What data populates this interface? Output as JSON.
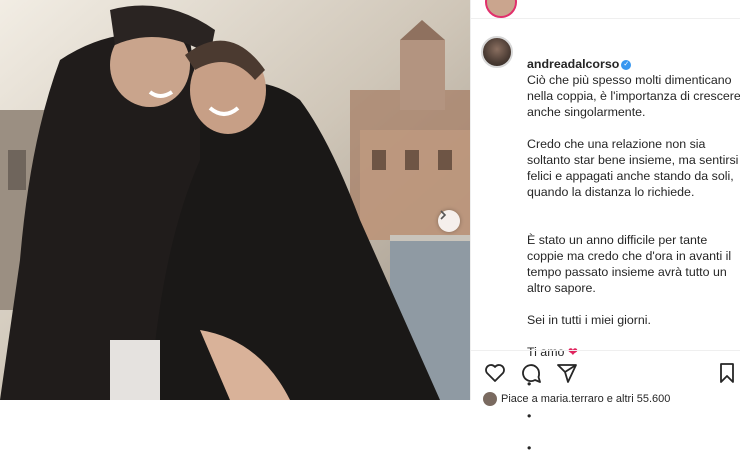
{
  "post": {
    "author": "andreadalcorso",
    "caption_first": "Ciò che più spesso molti dimenticano nella coppia, è l'importanza di crescere anche singolarmente.",
    "caption_p2": "Credo che una relazione non sia soltanto star bene insieme, ma sentirsi felici e appagati anche stando da soli, quando la distanza lo richiede.",
    "caption_p3_l1": "È stato un anno difficile per tante coppie ma credo che d'ora in avanti il tempo passato insieme avrà tutto un altro sapore.",
    "caption_p3_l2": "Sei in tutti i miei giorni.",
    "caption_p3_l3": "Ti amo",
    "bullets": [
      "•",
      "•",
      "•"
    ]
  },
  "footer": {
    "liked_text": "Piace a maria.terraro e altri 55.600"
  },
  "icons": {
    "verified": "verified-badge-icon",
    "heart_emoji": "red-heart-icon",
    "like": "heart-outline-icon",
    "comment": "comment-icon",
    "share": "paper-plane-icon",
    "save": "bookmark-icon",
    "next": "chevron-right-icon"
  },
  "colors": {
    "verified": "#3897f0",
    "heart": "#e0245e",
    "text": "#262626"
  }
}
